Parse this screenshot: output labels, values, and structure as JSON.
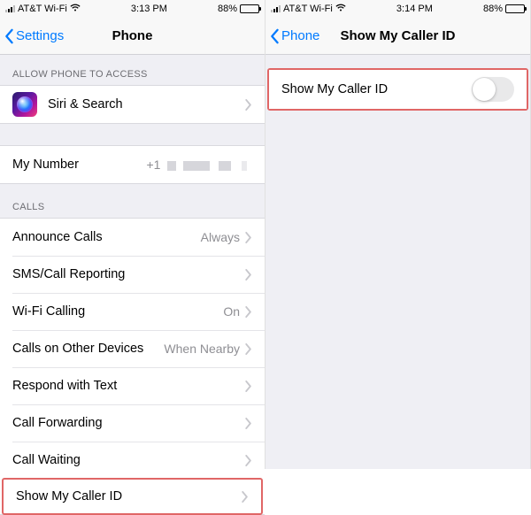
{
  "left": {
    "status": {
      "carrier": "AT&T Wi-Fi",
      "time": "3:13 PM",
      "battery_pct": "88%"
    },
    "nav": {
      "back": "Settings",
      "title": "Phone"
    },
    "section_access": "ALLOW PHONE TO ACCESS",
    "siri_label": "Siri & Search",
    "my_number_label": "My Number",
    "my_number_value": "+1",
    "section_calls": "CALLS",
    "calls": [
      {
        "label": "Announce Calls",
        "value": "Always"
      },
      {
        "label": "SMS/Call Reporting",
        "value": ""
      },
      {
        "label": "Wi-Fi Calling",
        "value": "On"
      },
      {
        "label": "Calls on Other Devices",
        "value": "When Nearby"
      },
      {
        "label": "Respond with Text",
        "value": ""
      },
      {
        "label": "Call Forwarding",
        "value": ""
      },
      {
        "label": "Call Waiting",
        "value": ""
      },
      {
        "label": "Show My Caller ID",
        "value": ""
      }
    ]
  },
  "right": {
    "status": {
      "carrier": "AT&T Wi-Fi",
      "time": "3:14 PM",
      "battery_pct": "88%"
    },
    "nav": {
      "back": "Phone",
      "title": "Show My Caller ID"
    },
    "row_label": "Show My Caller ID",
    "toggle_on": false
  }
}
